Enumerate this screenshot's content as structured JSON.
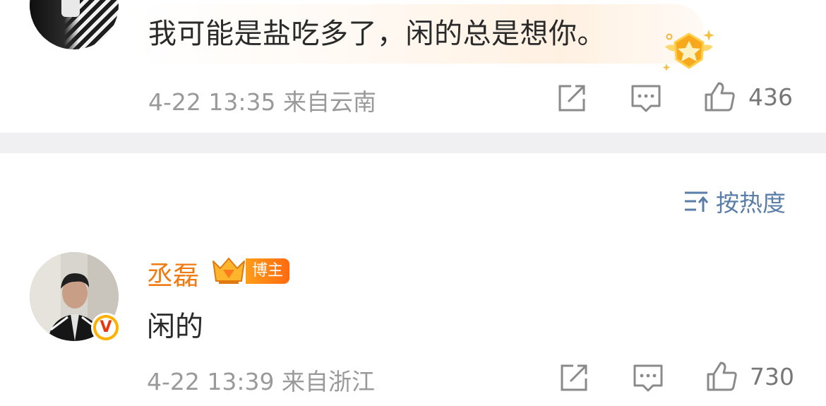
{
  "post1": {
    "comment": "我可能是盐吃多了，闲的总是想你。",
    "meta": "4-22 13:35  来自云南",
    "like_count": "436",
    "icons": {
      "repost": "share-edit-icon",
      "comment": "comment-icon",
      "like": "thumb-up-icon",
      "badge": "gold-star-badge-icon"
    }
  },
  "sort": {
    "label": "按热度",
    "icon": "sort-lines-arrow-icon"
  },
  "post2": {
    "username": "丞磊",
    "role_badge": "博主",
    "comment": "闲的",
    "meta": "4-22 13:39  来自浙江",
    "like_count": "730",
    "verified_mark": "V",
    "icons": {
      "repost": "share-edit-icon",
      "comment": "comment-icon",
      "like": "thumb-up-icon",
      "crown": "crown-badge-icon"
    }
  },
  "colors": {
    "username": "#f07b12",
    "link_blue": "#5a7ea8",
    "meta_gray": "#9a9a9a",
    "divider": "#f0f0f2",
    "badge_orange": "#ff8a12"
  }
}
